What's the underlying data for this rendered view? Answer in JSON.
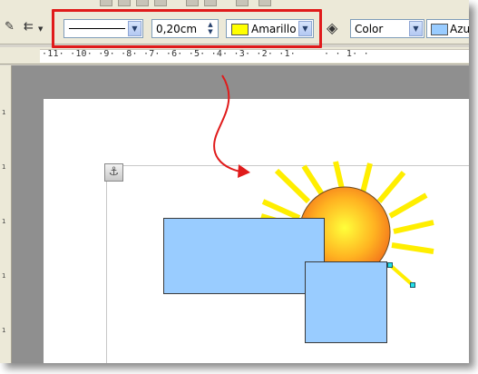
{
  "toolbar": {
    "line_width": "0,20cm",
    "line_color": "Amarillo",
    "line_color_swatch": "#ffff00",
    "area_style": "Color",
    "area_color_label": "Azu",
    "area_color_swatch": "#99ccff"
  },
  "ruler": {
    "text": "·11· ·10· ·9· ·8· ·7· ·6· ·5· ·4· ·3· ·2· ·1·     · · 1· ·"
  },
  "vruler": [
    "1",
    "1",
    "1",
    "1",
    "1"
  ],
  "canvas": {
    "shape_fill": "#99ccff",
    "sun_ray_color": "#ffee00",
    "annotation_color": "#e01b1b"
  },
  "icons": [
    "pencil-icon",
    "arrow-style-icon",
    "anchor-icon",
    "paint-bucket-icon"
  ]
}
